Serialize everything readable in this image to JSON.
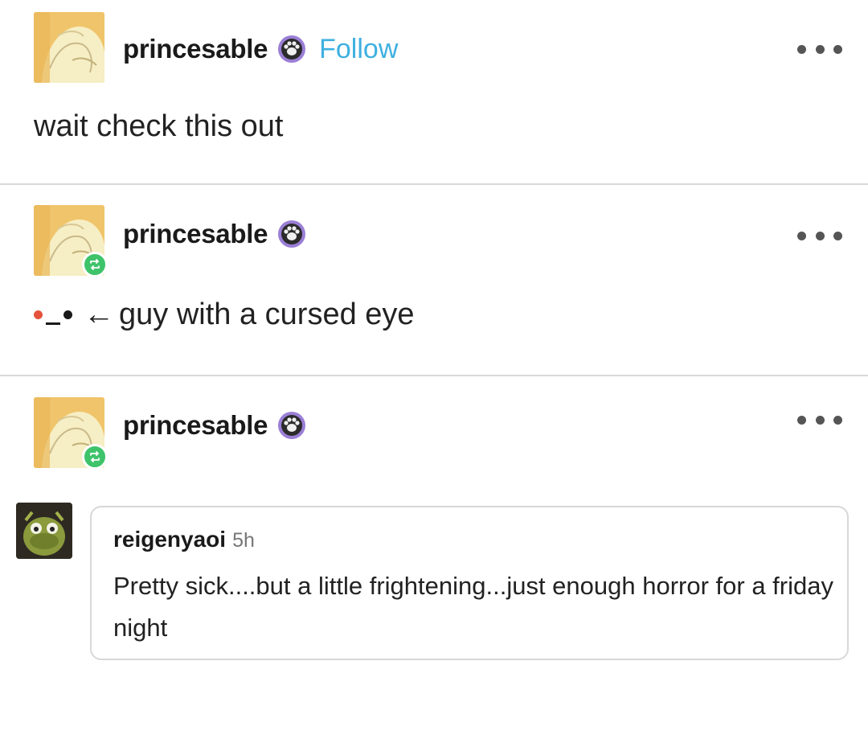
{
  "posts": [
    {
      "username": "princesable",
      "follow_label": "Follow",
      "text": "wait check this out",
      "badge_icon": "paw-icon",
      "reblogged": false
    },
    {
      "username": "princesable",
      "text": "guy with a cursed eye",
      "arrow": "←",
      "badge_icon": "paw-icon",
      "reblogged": true
    },
    {
      "username": "princesable",
      "badge_icon": "paw-icon",
      "reblogged": true
    }
  ],
  "comment": {
    "username": "reigenyaoi",
    "time": "5h",
    "text": "Pretty sick....but a little frightening...just enough horror for a friday night"
  },
  "colors": {
    "follow": "#3eb0e0",
    "reblog_badge": "#3ec36a",
    "cursed_eye": "#e5533d",
    "badge_ring": "#9b7fd6"
  }
}
